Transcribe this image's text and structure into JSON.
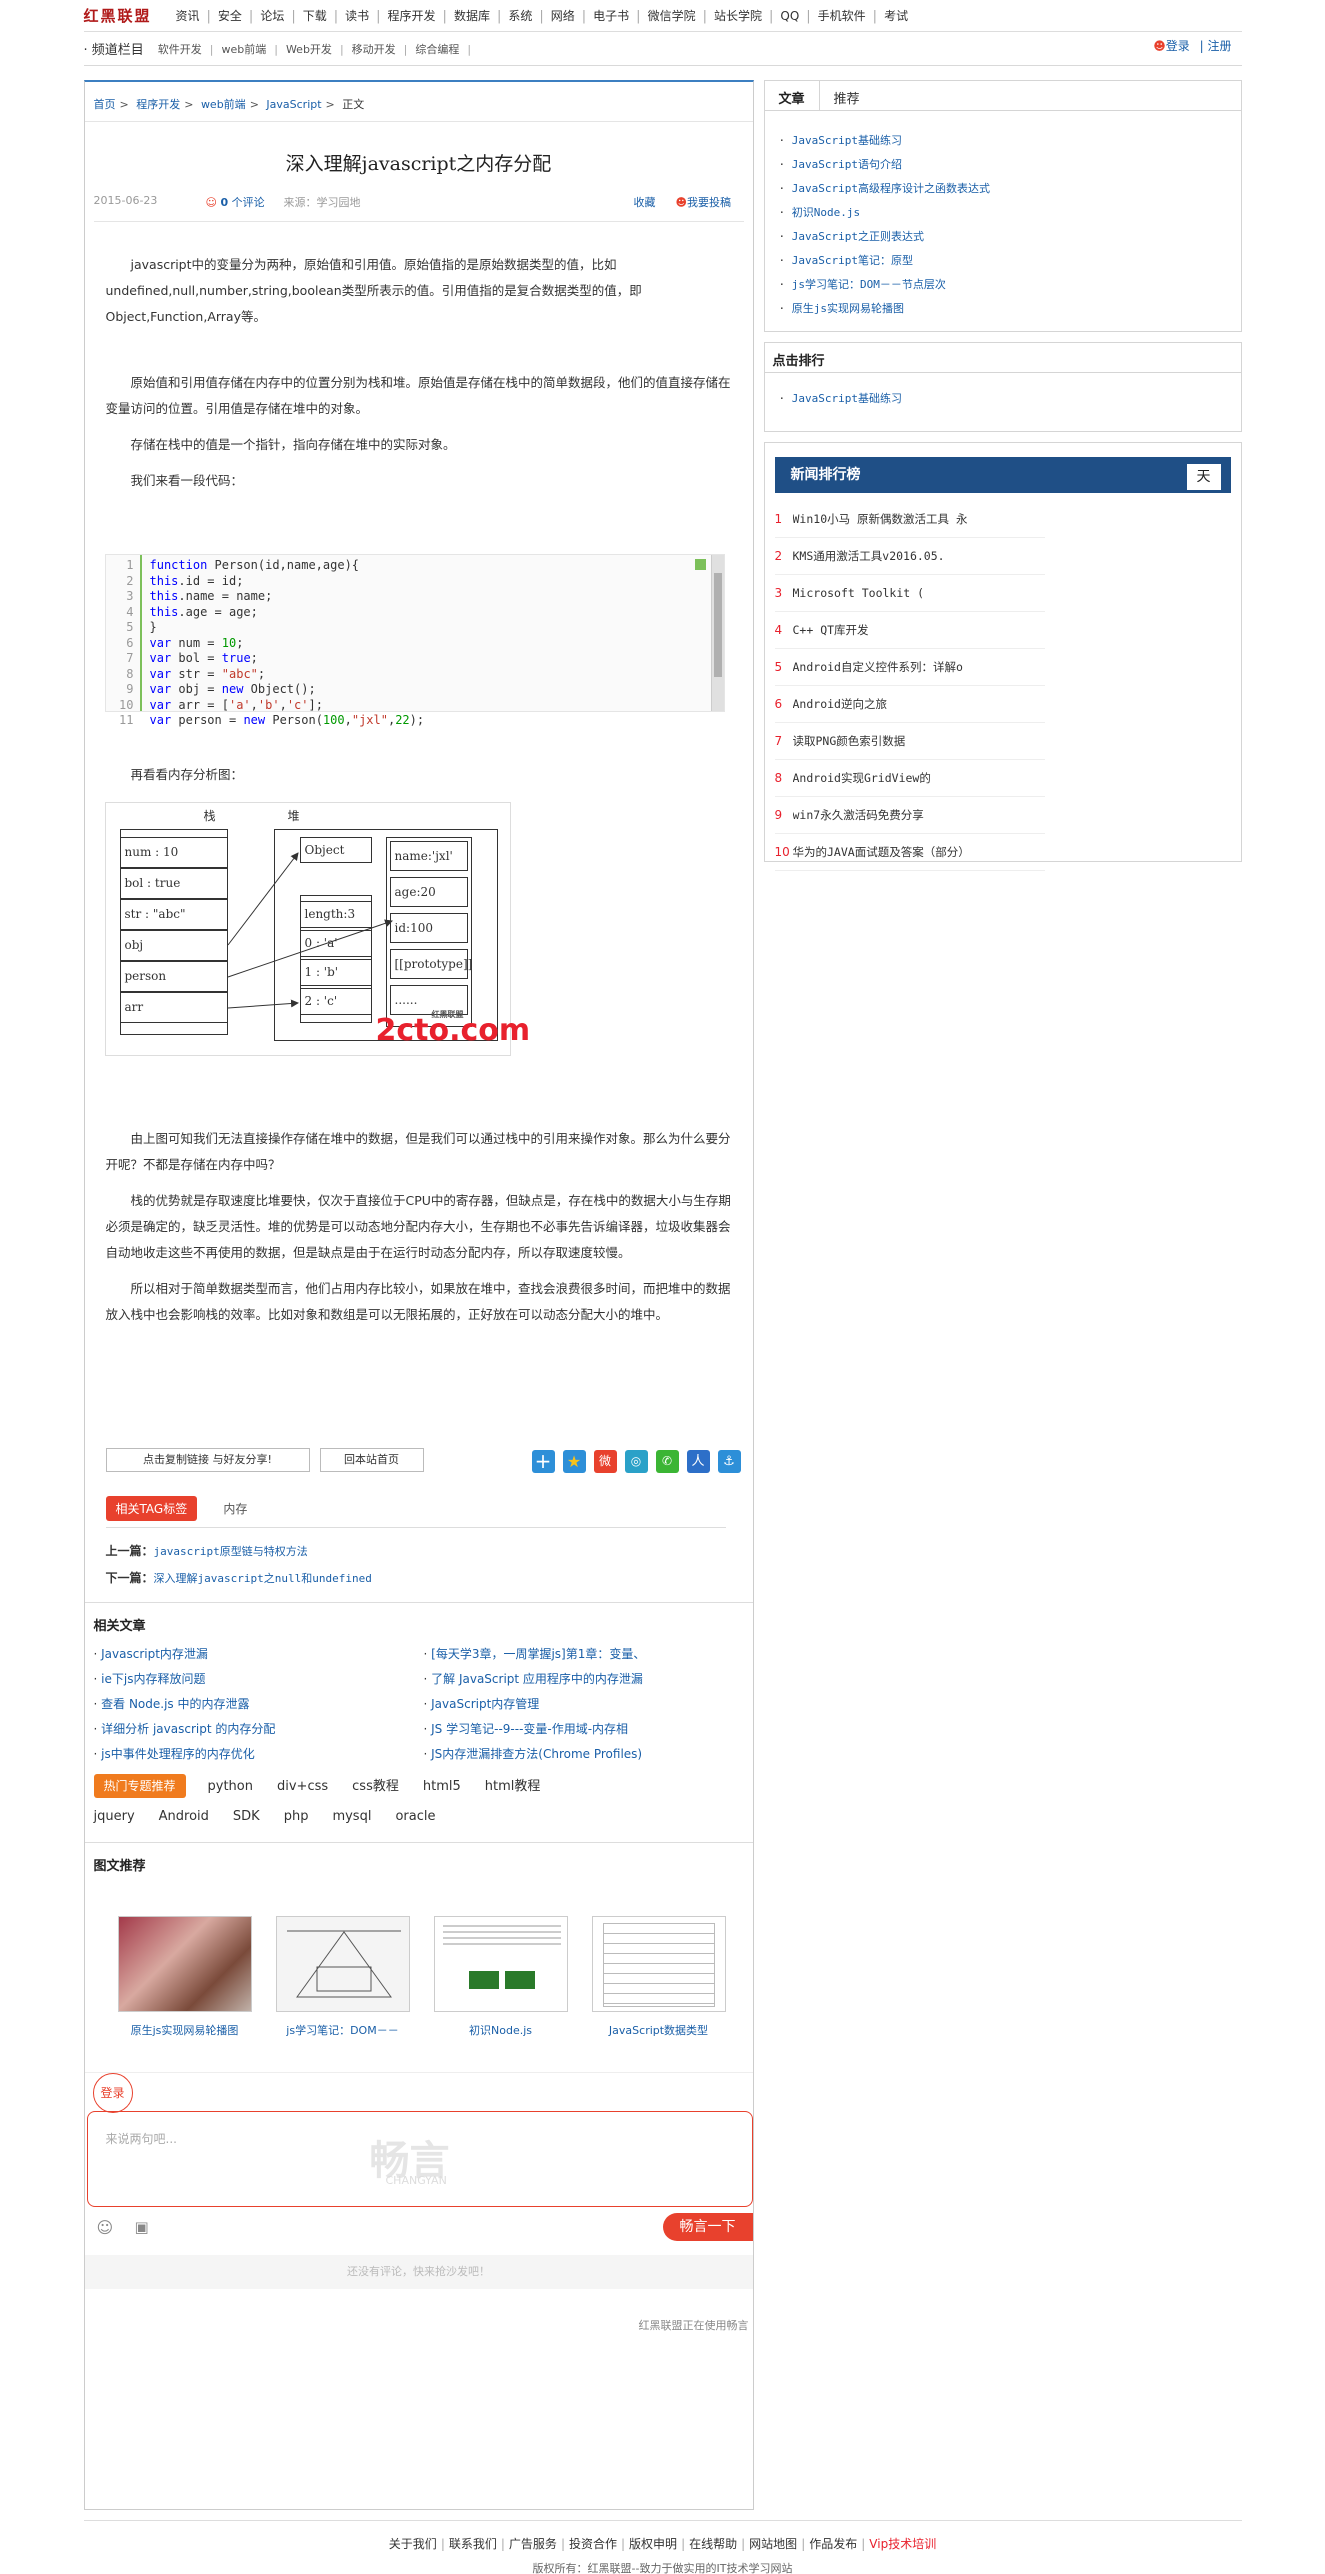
{
  "site": {
    "logo": "红黑联盟"
  },
  "topnav": [
    "资讯",
    "安全",
    "论坛",
    "下载",
    "读书",
    "程序开发",
    "数据库",
    "系统",
    "网络",
    "电子书",
    "微信学院",
    "站长学院",
    "QQ",
    "手机软件",
    "考试"
  ],
  "subnav": {
    "label": "· 频道栏目",
    "items": [
      "软件开发",
      "web前端",
      "Web开发",
      "移动开发",
      "综合编程"
    ]
  },
  "user": {
    "login": "登录",
    "register": "注册"
  },
  "breadcrumb": [
    "首页",
    "程序开发",
    "web前端",
    "JavaScript",
    "正文"
  ],
  "article": {
    "title": "深入理解javascript之内存分配",
    "date": "2015-06-23",
    "comments": "0",
    "comments_label": "个评论",
    "source": "来源：学习园地",
    "favorite": "收藏",
    "contribute": "我要投稿",
    "paragraphs": [
      "javascript中的变量分为两种，原始值和引用值。原始值指的是原始数据类型的值，比如undefined,null,number,string,boolean类型所表示的值。引用值指的是复合数据类型的值，即Object,Function,Array等。",
      "原始值和引用值存储在内存中的位置分别为栈和堆。原始值是存储在栈中的简单数据段，他们的值直接存储在变量访问的位置。引用值是存储在堆中的对象。",
      "存储在栈中的值是一个指针，指向存储在堆中的实际对象。",
      "我们来看一段代码：",
      "再看看内存分析图：",
      "由上图可知我们无法直接操作存储在堆中的数据，但是我们可以通过栈中的引用来操作对象。那么为什么要分开呢？不都是存储在内存中吗？",
      "栈的优势就是存取速度比堆要快，仅次于直接位于CPU中的寄存器，但缺点是，存在栈中的数据大小与生存期必须是确定的，缺乏灵活性。堆的优势是可以动态地分配内存大小，生存期也不必事先告诉编译器，垃圾收集器会自动地收走这些不再使用的数据，但是缺点是由于在运行时动态分配内存，所以存取速度较慢。",
      "所以相对于简单数据类型而言，他们占用内存比较小，如果放在堆中，查找会浪费很多时间，而把堆中的数据放入栈中也会影响栈的效率。比如对象和数组是可以无限拓展的，正好放在可以动态分配大小的堆中。"
    ],
    "code_lines": [
      "function Person(id,name,age){",
      "this.id = id;",
      "this.name = name;",
      "this.age = age;",
      "}",
      "var num = 10;",
      "var bol = true;",
      "var str = \"abc\";",
      "var obj = new Object();",
      "var arr = ['a','b','c'];",
      "var person = new Person(100,\"jxl\",22);"
    ]
  },
  "diagram": {
    "stack_label": "栈",
    "heap_label": "堆",
    "stack": [
      "num : 10",
      "bol : true",
      "str : \"abc\"",
      "obj",
      "person",
      "arr"
    ],
    "object": "Object",
    "array": [
      "length:3",
      "0 : 'a'",
      "1 : 'b'",
      "2 : 'c'"
    ],
    "person": [
      "name:'jxl'",
      "age:20",
      "id:100",
      "[[prototype]]",
      "......"
    ],
    "watermark": "2cto.com",
    "watermark_sub": "红黑联盟"
  },
  "share": {
    "copy_link": "点击复制链接 与好友分享!",
    "home": "回本站首页"
  },
  "tags": {
    "label": "相关TAG标签",
    "items": [
      "内存"
    ]
  },
  "prev": {
    "label": "上一篇：",
    "title": "javascript原型链与特权方法"
  },
  "next": {
    "label": "下一篇：",
    "title": "深入理解javascript之null和undefined"
  },
  "related": {
    "title": "相关文章",
    "items": [
      "Javascript内存泄漏",
      "[每天学3章，一周掌握js]第1章：变量、",
      "ie下js内存释放问题",
      "了解 JavaScript 应用程序中的内存泄漏",
      "查看 Node.js 中的内存泄露",
      "JavaScript内存管理",
      "详细分析 javascript 的内存分配",
      "JS 学习笔记--9---变量-作用域-内存相",
      "js中事件处理程序的内存优化",
      "JS内存泄漏排查方法(Chrome Profiles)"
    ]
  },
  "hot": {
    "label": "热门专题推荐",
    "items": [
      "python",
      "div+css",
      "css教程",
      "html5",
      "html教程",
      "jquery",
      "Android",
      "SDK",
      "php",
      "mysql",
      "oracle"
    ]
  },
  "image_rec": {
    "title": "图文推荐",
    "items": [
      "原生js实现网易轮播图",
      "js学习笔记：DOM－－",
      "初识Node.js",
      "JavaScript数据类型"
    ]
  },
  "comment": {
    "login": "登录",
    "placeholder": "来说两句吧...",
    "brand": "畅言",
    "brand_en": "CHANGYAN",
    "post": "畅言一下",
    "empty": "还没有评论，快来抢沙发吧！",
    "powered": "红黑联盟正在使用畅言"
  },
  "sidebar": {
    "tabs": [
      "文章",
      "推荐"
    ],
    "articles": [
      "JavaScript基础练习",
      "JavaScript语句介绍",
      "JavaScript高级程序设计之函数表达式",
      "初识Node.js",
      "JavaScript之正则表达式",
      "JavaScript笔记：原型",
      "js学习笔记：DOM－－节点层次",
      "原生js实现网易轮播图"
    ],
    "click_rank_title": "点击排行",
    "click_rank": [
      "JavaScript基础练习"
    ],
    "news_title": "新闻排行榜",
    "news_tab": "天",
    "news": [
      "Win10小马 原新偶数激活工具 永",
      "KMS通用激活工具v2016.05.",
      "Microsoft Toolkit (",
      "C++ QT库开发",
      "Android自定义控件系列：详解o",
      "Android逆向之旅",
      "读取PNG颜色索引数据",
      "Android实现GridView的",
      "win7永久激活码免费分享",
      "华为的JAVA面试题及答案（部分）"
    ]
  },
  "footer": {
    "links": [
      "关于我们",
      "联系我们",
      "广告服务",
      "投资合作",
      "版权申明",
      "在线帮助",
      "网站地图",
      "作品发布"
    ],
    "vip": "Vip技术培训",
    "copyright": "版权所有：红黑联盟--致力于做实用的IT技术学习网站"
  },
  "colors": {
    "accent_blue": "#1a5fa8",
    "brand_red": "#e8412d",
    "news_header": "#1f4f86",
    "hot_orange": "#f07b1e"
  }
}
